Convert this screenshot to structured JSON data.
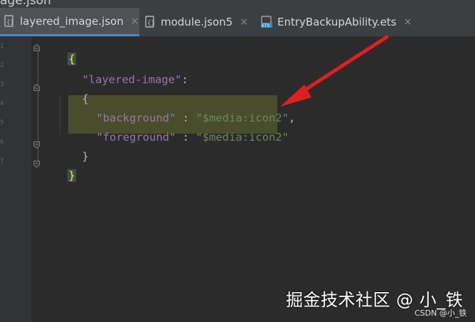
{
  "window": {
    "title_fragment": "age.json"
  },
  "tabs": [
    {
      "label": "layered_image.json",
      "icon": "json-file-icon",
      "active": true,
      "close": "×"
    },
    {
      "label": "module.json5",
      "icon": "json5-file-icon",
      "active": false,
      "close": "×"
    },
    {
      "label": "EntryBackupAbility.ets",
      "icon": "ets-file-icon",
      "active": false,
      "close": "×"
    }
  ],
  "editor": {
    "lines": [
      {
        "text": "{"
      },
      {
        "key": "\"layered-image\"",
        "sep": ":"
      },
      {
        "text": "{"
      },
      {
        "key": "\"background\"",
        "sep": " : ",
        "value": "\"$media:icon2\"",
        "trail": ","
      },
      {
        "key": "\"foreground\"",
        "sep": " : ",
        "value": "\"$media:icon2\""
      },
      {
        "text": "}"
      },
      {
        "text": "}"
      }
    ],
    "line_numbers": [
      "1",
      "2",
      "3",
      "4",
      "5",
      "6",
      "7"
    ]
  },
  "watermark": {
    "main": "掘金技术社区 @ 小_铁",
    "sub": "CSDN @小_铁"
  },
  "colors": {
    "background": "#2b2b2b",
    "key": "#9876aa",
    "string": "#6a8759",
    "arrow": "#e02020",
    "active_tab_underline": "#4a88c7"
  }
}
